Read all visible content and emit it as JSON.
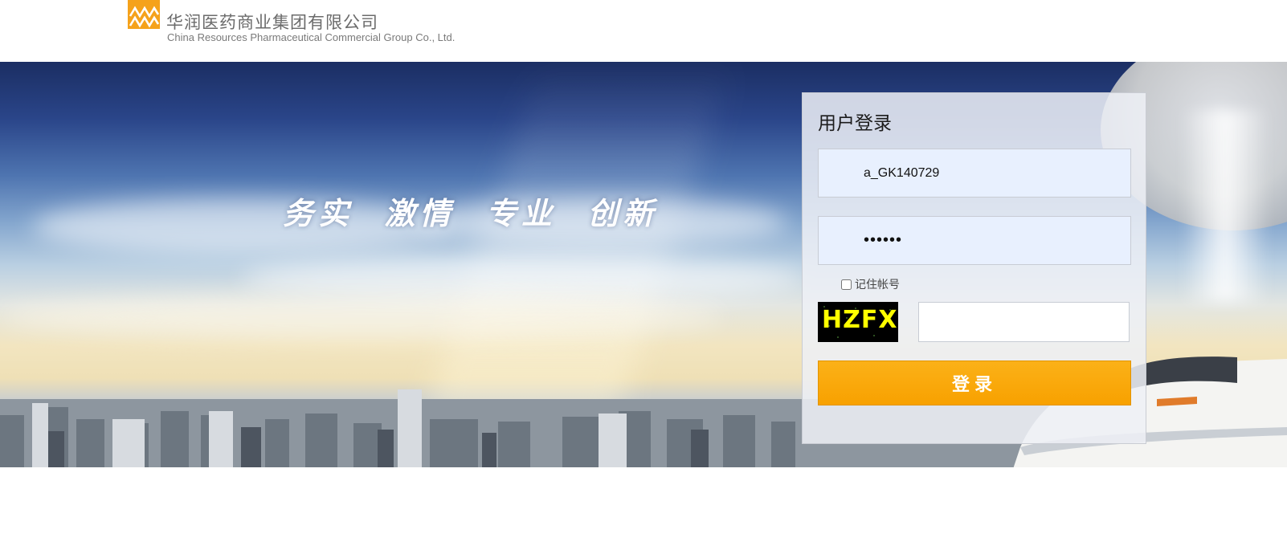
{
  "header": {
    "company_name_cn": "华润医药商业集团有限公司",
    "company_name_en": "China Resources Pharmaceutical Commercial Group Co., Ltd.",
    "logo_icon": "cr-pharma-logo-icon",
    "logo_color": "#f5a21b"
  },
  "banner": {
    "slogan": "务实  激情  专业  创新"
  },
  "login": {
    "title": "用户登录",
    "username_value": "a_GK140729",
    "password_value": "••••••",
    "remember_label": "记住帐号",
    "remember_checked": false,
    "captcha_text": "HZFX",
    "captcha_input_value": "",
    "submit_label": "登录",
    "accent_color": "#f8a100"
  }
}
